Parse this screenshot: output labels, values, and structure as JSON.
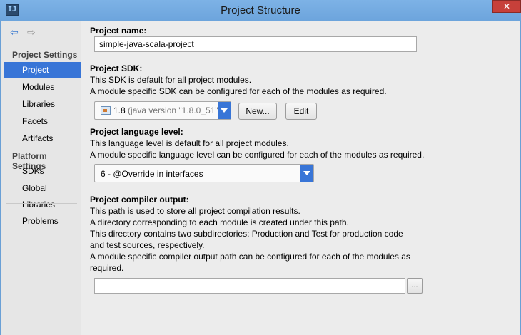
{
  "window": {
    "title": "Project Structure",
    "app_icon": "IJ",
    "close_glyph": "✕"
  },
  "sidebar": {
    "back_icon": "⇦",
    "forward_icon": "⇨",
    "project_settings_header": "Project Settings",
    "project_settings_items": [
      {
        "label": "Project",
        "selected": true
      },
      {
        "label": "Modules",
        "selected": false
      },
      {
        "label": "Libraries",
        "selected": false
      },
      {
        "label": "Facets",
        "selected": false
      },
      {
        "label": "Artifacts",
        "selected": false
      }
    ],
    "platform_settings_header": "Platform Settings",
    "platform_settings_items": [
      {
        "label": "SDKs"
      },
      {
        "label": "Global Libraries"
      }
    ],
    "problems_label": "Problems"
  },
  "project_name": {
    "label": "Project name:",
    "value": "simple-java-scala-project"
  },
  "project_sdk": {
    "label": "Project SDK:",
    "desc1": "This SDK is default for all project modules.",
    "desc2": "A module specific SDK can be configured for each of the modules as required.",
    "selected_version": "1.8",
    "selected_detail": "(java version \"1.8.0_51\")",
    "new_button": "New...",
    "edit_button": "Edit"
  },
  "language_level": {
    "label": "Project language level:",
    "desc1": "This language level is default for all project modules.",
    "desc2": "A module specific language level can be configured for each of the modules as required.",
    "selected": "6 - @Override in interfaces"
  },
  "compiler_output": {
    "label": "Project compiler output:",
    "lines": [
      "This path is used to store all project compilation results.",
      "A directory corresponding to each module is created under this path.",
      "This directory contains two subdirectories: Production and Test for production code",
      "and test sources, respectively.",
      "A module specific compiler output path can be configured for each of the modules as",
      "required."
    ],
    "value": "",
    "browse_label": "..."
  },
  "colors": {
    "selection": "#3875d7",
    "title_bar": "#6ca4dc",
    "close": "#c7403a"
  }
}
